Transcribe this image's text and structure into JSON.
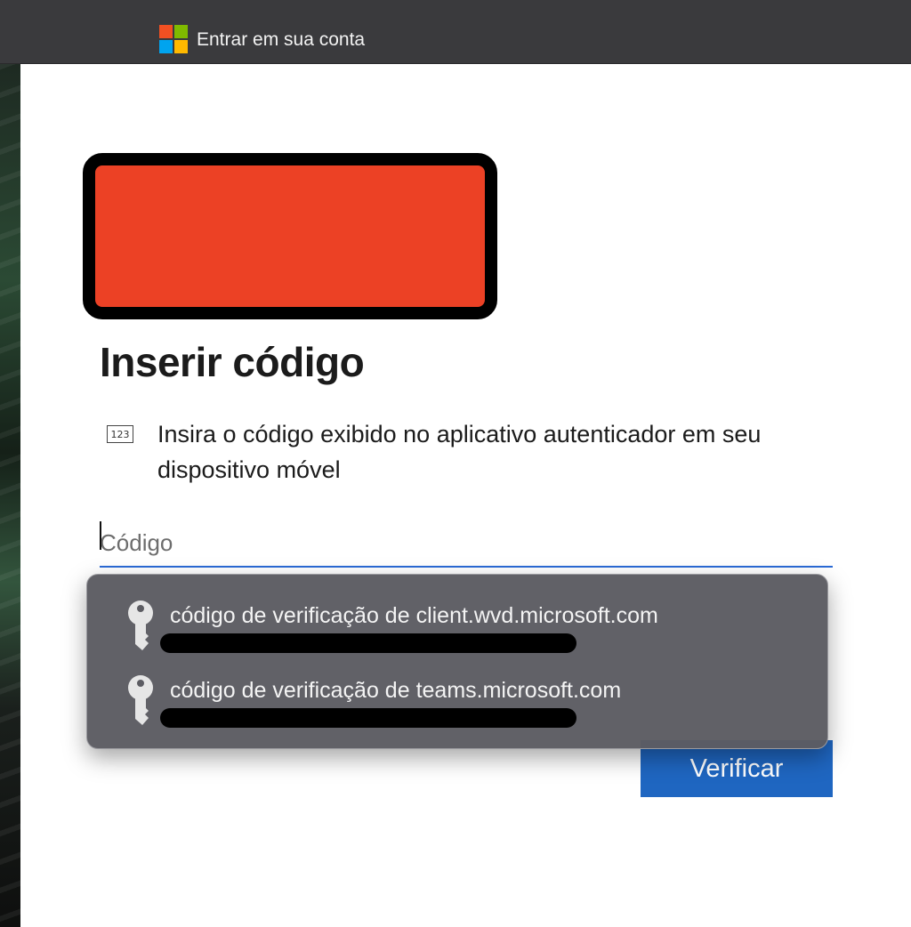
{
  "window": {
    "title": "Entrar em sua conta",
    "logo_colors": [
      "#f25022",
      "#7fba00",
      "#00a4ef",
      "#ffb900"
    ]
  },
  "page": {
    "heading": "Inserir código",
    "icon_text": "123",
    "description": "Insira o código exibido no aplicativo autenticador em seu dispositivo móvel",
    "code_placeholder": "Código",
    "code_value": "",
    "verify_label": "Verificar",
    "accent_color": "#1f66c1",
    "redaction_color": "#ec4125"
  },
  "autofill": {
    "items": [
      {
        "label": "código de verificação de client.wvd.microsoft.com",
        "icon": "key-icon"
      },
      {
        "label": "código de verificação de teams.microsoft.com",
        "icon": "key-icon"
      }
    ]
  }
}
